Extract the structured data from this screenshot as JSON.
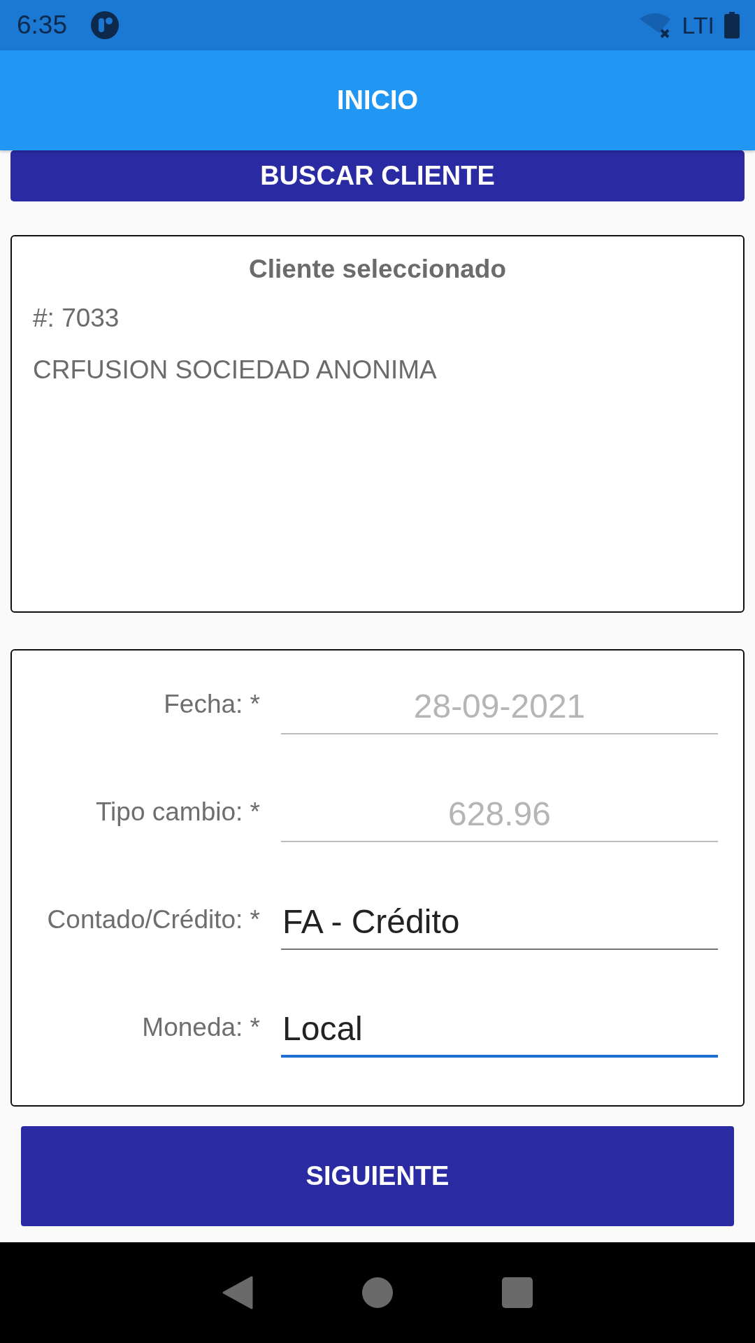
{
  "status_bar": {
    "time": "6:35",
    "network": "LTI"
  },
  "app_bar": {
    "title": "INICIO"
  },
  "search_button": {
    "label": "BUSCAR CLIENTE"
  },
  "client_card": {
    "title": "Cliente seleccionado",
    "number": "#: 7033",
    "name": "CRFUSION SOCIEDAD ANONIMA"
  },
  "form": {
    "fields": [
      {
        "label": "Fecha: *",
        "value": "28-09-2021",
        "disabled": true,
        "focused": false
      },
      {
        "label": "Tipo cambio: *",
        "value": "628.96",
        "disabled": true,
        "focused": false
      },
      {
        "label": "Contado/Crédito: *",
        "value": "FA - Crédito",
        "disabled": false,
        "focused": false
      },
      {
        "label": "Moneda: *",
        "value": "Local",
        "disabled": false,
        "focused": true
      }
    ]
  },
  "next_button": {
    "label": "SIGUIENTE"
  }
}
